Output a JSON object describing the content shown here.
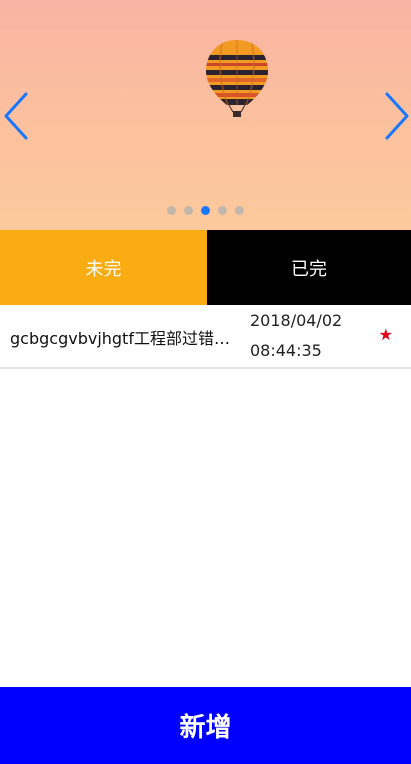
{
  "carousel": {
    "image": "hot-air-balloon",
    "prev_icon": "chevron-left-icon",
    "next_icon": "chevron-right-icon",
    "dot_count": 5,
    "active_index": 2,
    "colors": {
      "arrow": "#1677ff",
      "active_dot": "#1677ff",
      "inactive_dot": "#bdb4ad"
    }
  },
  "tabs": [
    {
      "label": "未完",
      "color": "#fbac13"
    },
    {
      "label": "已完",
      "color": "#000000"
    }
  ],
  "tasks": [
    {
      "title": "gcbgcgvbvjhgtf工程部过错过错反反复复",
      "date": "2018/04/02",
      "time": "08:44:35",
      "starred": true,
      "star_icon": "star-icon",
      "star_color": "#e3001b"
    }
  ],
  "footer": {
    "add_label": "新增",
    "color": "#0000ff"
  }
}
